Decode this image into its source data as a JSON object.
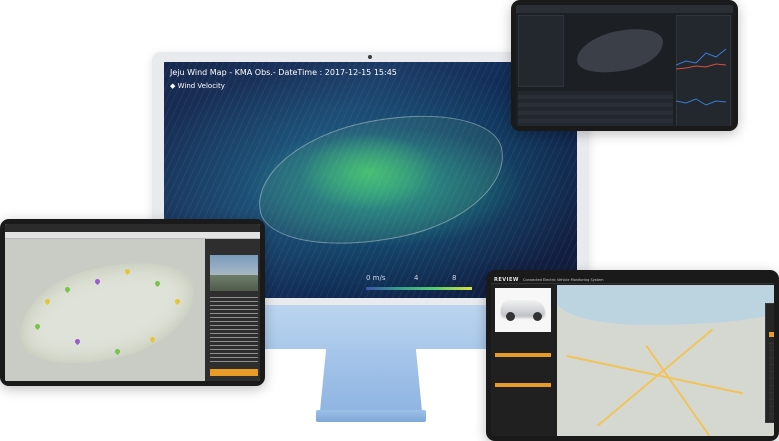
{
  "imac": {
    "title": "Jeju Wind Map - KMA Obs.- DateTime : 2017-12-15 15:45",
    "subtitle": "Wind Velocity",
    "legend": {
      "l0": "0 m/s",
      "l1": "4",
      "l2": "8"
    }
  },
  "review_tablet": {
    "logo": "REVIEW",
    "subtitle": "Connected Electric Vehicle Monitoring System"
  },
  "colors": {
    "accent": "#e89c26",
    "wind_low": "#3b55a5",
    "wind_high": "#5ad06a"
  }
}
